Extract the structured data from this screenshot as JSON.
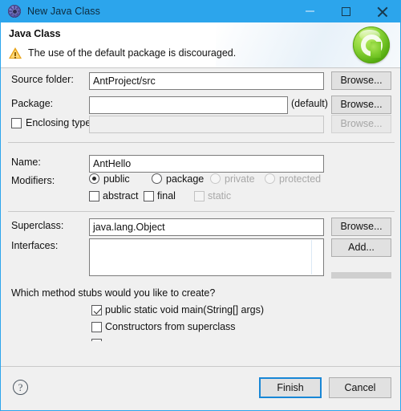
{
  "window": {
    "title": "New Java Class",
    "icon": "gear-icon",
    "controls": {
      "minimize": "minimize-icon",
      "maximize": "maximize-icon",
      "close": "close-icon"
    }
  },
  "header": {
    "title": "Java Class",
    "message": "The use of the default package is discouraged.",
    "message_icon": "warning-icon",
    "logo": "java-class-logo",
    "accent_color": "#2ca5ec",
    "warning_color": "#e8a317",
    "logo_color": "#7ccb2b"
  },
  "form": {
    "source_folder": {
      "label": "Source folder:",
      "value": "AntProject/src",
      "placeholder": "",
      "browse_label": "Browse..."
    },
    "package": {
      "label": "Package:",
      "value": "",
      "placeholder": "",
      "suffix": "(default)",
      "browse_label": "Browse..."
    },
    "enclosing_type": {
      "label": "Enclosing type:",
      "checked": false,
      "value": "",
      "browse_label": "Browse...",
      "enabled": false
    },
    "name": {
      "label": "Name:",
      "value": "AntHello",
      "placeholder": ""
    },
    "modifiers": {
      "label": "Modifiers:",
      "radios": [
        {
          "label": "public",
          "selected": true,
          "enabled": true
        },
        {
          "label": "package",
          "selected": false,
          "enabled": true
        },
        {
          "label": "private",
          "selected": false,
          "enabled": false
        },
        {
          "label": "protected",
          "selected": false,
          "enabled": false
        }
      ],
      "checkboxes": [
        {
          "label": "abstract",
          "checked": false,
          "enabled": true
        },
        {
          "label": "final",
          "checked": false,
          "enabled": true
        },
        {
          "label": "static",
          "checked": false,
          "enabled": false
        }
      ]
    },
    "superclass": {
      "label": "Superclass:",
      "value": "java.lang.Object",
      "browse_label": "Browse..."
    },
    "interfaces": {
      "label": "Interfaces:",
      "items": [],
      "add_label": "Add...",
      "remove_label": ""
    },
    "method_stubs": {
      "question": "Which method stubs would you like to create?",
      "options": [
        {
          "label": "public static void main(String[] args)",
          "checked": true
        },
        {
          "label": "Constructors from superclass",
          "checked": false
        }
      ]
    }
  },
  "footer": {
    "help_label": "?",
    "finish_label": "Finish",
    "cancel_label": "Cancel"
  }
}
